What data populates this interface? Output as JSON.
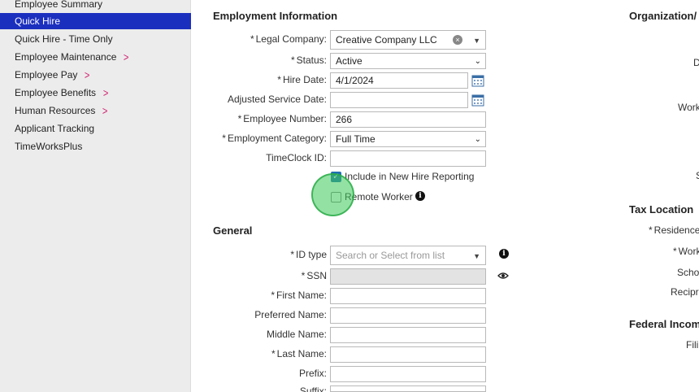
{
  "sidebar": {
    "items": [
      {
        "label": "Employee Summary",
        "chevron": false,
        "active": false
      },
      {
        "label": "Quick Hire",
        "chevron": false,
        "active": true
      },
      {
        "label": "Quick Hire - Time Only",
        "chevron": false,
        "active": false
      },
      {
        "label": "Employee Maintenance",
        "chevron": true,
        "active": false
      },
      {
        "label": "Employee Pay",
        "chevron": true,
        "active": false
      },
      {
        "label": "Employee Benefits",
        "chevron": true,
        "active": false
      },
      {
        "label": "Human Resources",
        "chevron": true,
        "active": false
      },
      {
        "label": "Applicant Tracking",
        "chevron": false,
        "active": false
      },
      {
        "label": "TimeWorksPlus",
        "chevron": false,
        "active": false
      }
    ],
    "chevron_glyph": ">"
  },
  "employment": {
    "title": "Employment Information",
    "legal_company": {
      "label": "Legal Company:",
      "value": "Creative Company LLC"
    },
    "status": {
      "label": "Status:",
      "value": "Active"
    },
    "hire_date": {
      "label": "Hire Date:",
      "value": "4/1/2024"
    },
    "adjusted_service_date": {
      "label": "Adjusted Service Date:",
      "value": ""
    },
    "employee_number": {
      "label": "Employee Number:",
      "value": "266"
    },
    "employment_category": {
      "label": "Employment Category:",
      "value": "Full Time"
    },
    "timeclock_id": {
      "label": "TimeClock ID:",
      "value": ""
    },
    "new_hire_reporting": {
      "label": "Include in New Hire Reporting",
      "checked": true
    },
    "remote_worker": {
      "label": "Remote Worker",
      "checked": false
    }
  },
  "general": {
    "title": "General",
    "id_type": {
      "label": "ID type",
      "placeholder": "Search or Select from list"
    },
    "ssn": {
      "label": "SSN",
      "value": ""
    },
    "first_name": {
      "label": "First Name:",
      "value": ""
    },
    "preferred_name": {
      "label": "Preferred Name:",
      "value": ""
    },
    "middle_name": {
      "label": "Middle Name:",
      "value": ""
    },
    "last_name": {
      "label": "Last Name:",
      "value": ""
    },
    "prefix": {
      "label": "Prefix:",
      "value": ""
    },
    "suffix": {
      "label": "Suffix:",
      "value": ""
    }
  },
  "right_column": {
    "org_title": "Organization/",
    "d_label": "D",
    "work_label": "Work",
    "s_label": "S",
    "tax_title": "Tax Location",
    "residence_label": "Residence",
    "work2_label": "Work",
    "school_label": "Scho",
    "recip_label": "Recipr",
    "federal_title": "Federal Incom",
    "fili_label": "Fili"
  },
  "icons": {
    "info": "info-icon",
    "calendar": "calendar-icon",
    "eye": "eye-icon",
    "clear": "clear-icon",
    "check_glyph": "✓",
    "clear_glyph": "×",
    "select_caret": "⌄",
    "caret_down": "▼"
  },
  "colors": {
    "active_nav": "#1b2fbf",
    "chevron": "#d2226f",
    "checkbox_checked": "#1f6fb2",
    "click_indicator": "#3cc85a"
  }
}
